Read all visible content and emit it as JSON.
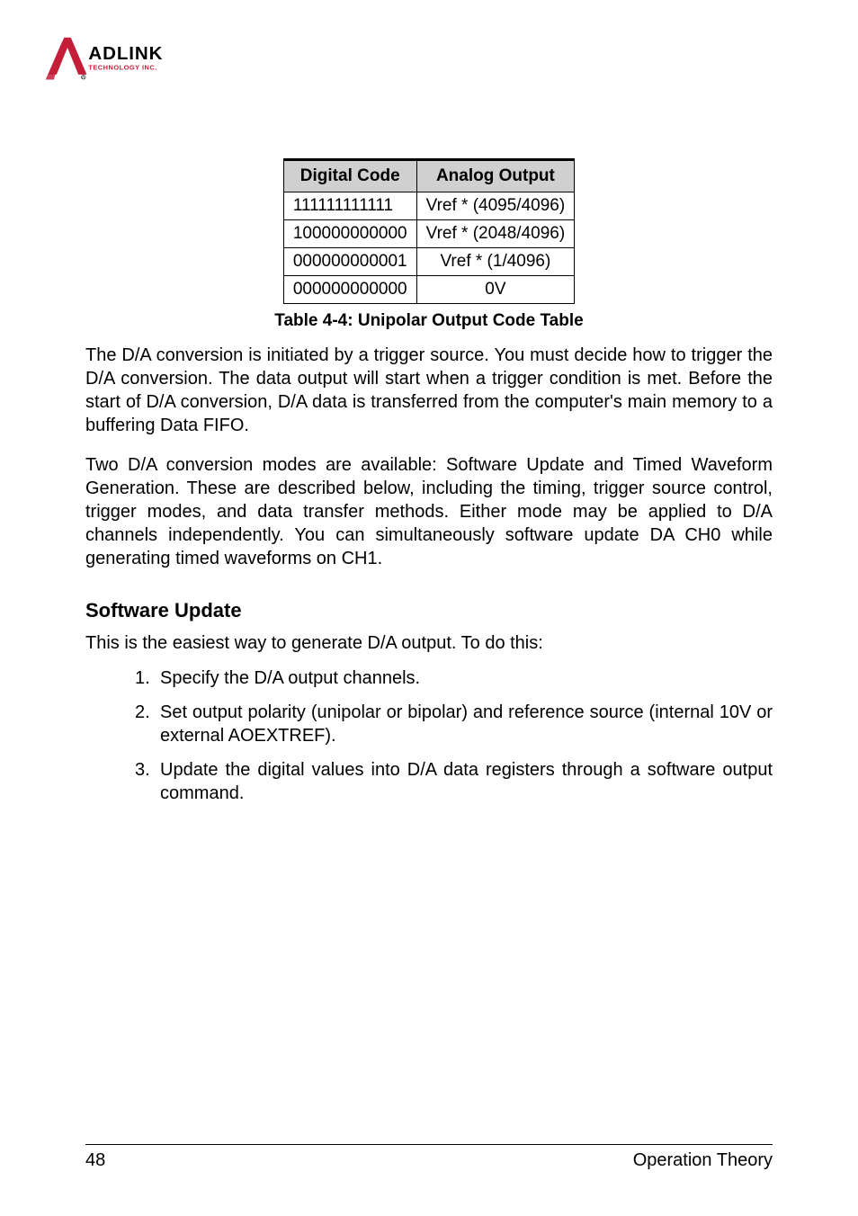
{
  "logo": {
    "name": "ADLINK",
    "sub": "TECHNOLOGY INC."
  },
  "table": {
    "headers": [
      "Digital Code",
      "Analog Output"
    ],
    "rows": [
      [
        "111111111111",
        "Vref * (4095/4096)"
      ],
      [
        "100000000000",
        "Vref * (2048/4096)"
      ],
      [
        "000000000001",
        "Vref * (1/4096)"
      ],
      [
        "000000000000",
        "0V"
      ]
    ],
    "caption": "Table  4-4: Unipolar Output Code Table"
  },
  "paragraphs": {
    "p1": "The D/A conversion is initiated by a trigger source. You must decide how to trigger the D/A conversion. The data output will start when a trigger condition is met. Before the start of D/A conversion, D/A data is transferred from the computer's main memory to a buffering Data FIFO.",
    "p2": "Two D/A conversion modes are available: Software Update and Timed Waveform Generation. These are described below, including the timing, trigger source control, trigger modes, and data transfer methods. Either mode may be applied to D/A channels independently. You can simultaneously software update DA CH0 while generating timed waveforms on CH1."
  },
  "section": {
    "heading": "Software Update",
    "intro": "This is the easiest way to generate D/A output. To do this:",
    "steps": [
      "Specify the D/A output channels.",
      "Set output polarity (unipolar or bipolar) and reference source (internal 10V or external AOEXTREF).",
      "Update the digital values into D/A data registers through a software output command."
    ]
  },
  "footer": {
    "page": "48",
    "title": "Operation Theory"
  }
}
